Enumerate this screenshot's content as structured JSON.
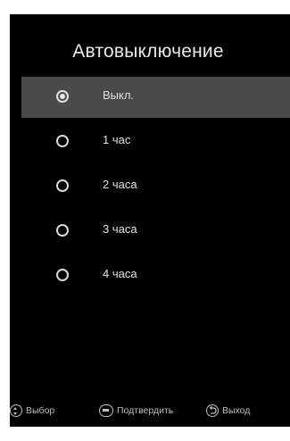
{
  "title": "Автовыключение",
  "options": [
    {
      "label": "Выкл.",
      "selected": true
    },
    {
      "label": "1 час",
      "selected": false
    },
    {
      "label": "2 часа",
      "selected": false
    },
    {
      "label": "3 часа",
      "selected": false
    },
    {
      "label": "4 часа",
      "selected": false
    }
  ],
  "footer": {
    "select": {
      "icon": "up-down-icon",
      "label": "Выбор"
    },
    "confirm": {
      "icon": "enter-button-icon",
      "label": "Подтвердить"
    },
    "exit": {
      "icon": "back-icon",
      "label": "Выход"
    }
  },
  "colors": {
    "background": "#000000",
    "highlight": "#4a4a4a",
    "text": "#e0e0e0"
  }
}
